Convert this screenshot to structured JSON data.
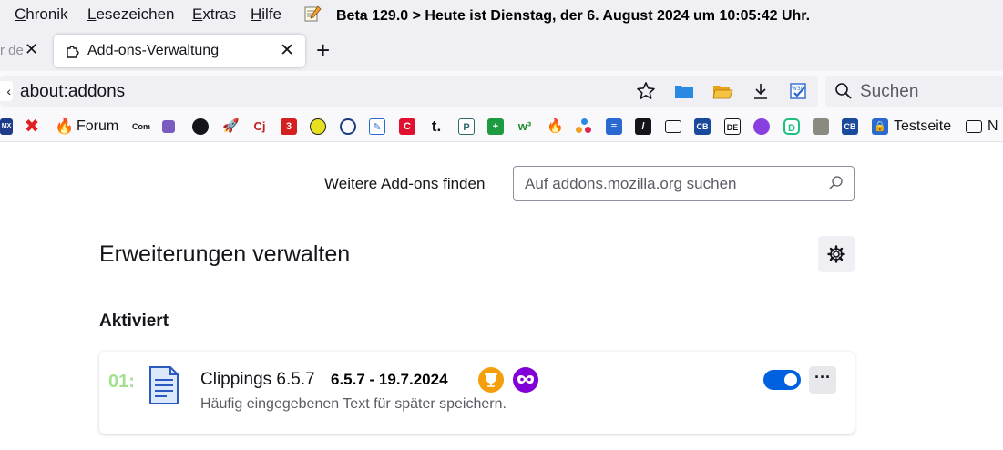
{
  "menubar": {
    "items": [
      {
        "first": "C",
        "rest": "hronik"
      },
      {
        "first": "L",
        "rest": "esezeichen"
      },
      {
        "first": "E",
        "rest": "xtras"
      },
      {
        "first": "H",
        "rest": "ilfe"
      }
    ],
    "beta_text": "Beta 129.0   >    Heute ist  Dienstag, der 6. August 2024 um 10:05:42 Uhr."
  },
  "tabs": {
    "partial_title": "r de",
    "active_title": "Add-ons-Verwaltung",
    "close_glyph": "✕",
    "new_tab_glyph": "+"
  },
  "navbar": {
    "url": "about:addons",
    "search_placeholder": "Suchen"
  },
  "bookmarks": {
    "forum_label": "Forum",
    "testseite_label": "Testseite",
    "n_label": "N"
  },
  "content": {
    "find_label": "Weitere Add-ons finden",
    "find_placeholder": "Auf addons.mozilla.org suchen",
    "page_title": "Erweiterungen verwalten",
    "section_title": "Aktiviert"
  },
  "addon": {
    "number": "01:",
    "name": "Clippings 6.5.7",
    "version_info": "6.5.7 - 19.7.2024",
    "description": "Häufig eingegebenen Text für später speichern.",
    "enabled": true,
    "more_glyph": "···"
  },
  "colors": {
    "accent": "#0061e0",
    "number_green": "#a3e08f",
    "trophy": "#f59e0b",
    "private": "#8000d7"
  }
}
